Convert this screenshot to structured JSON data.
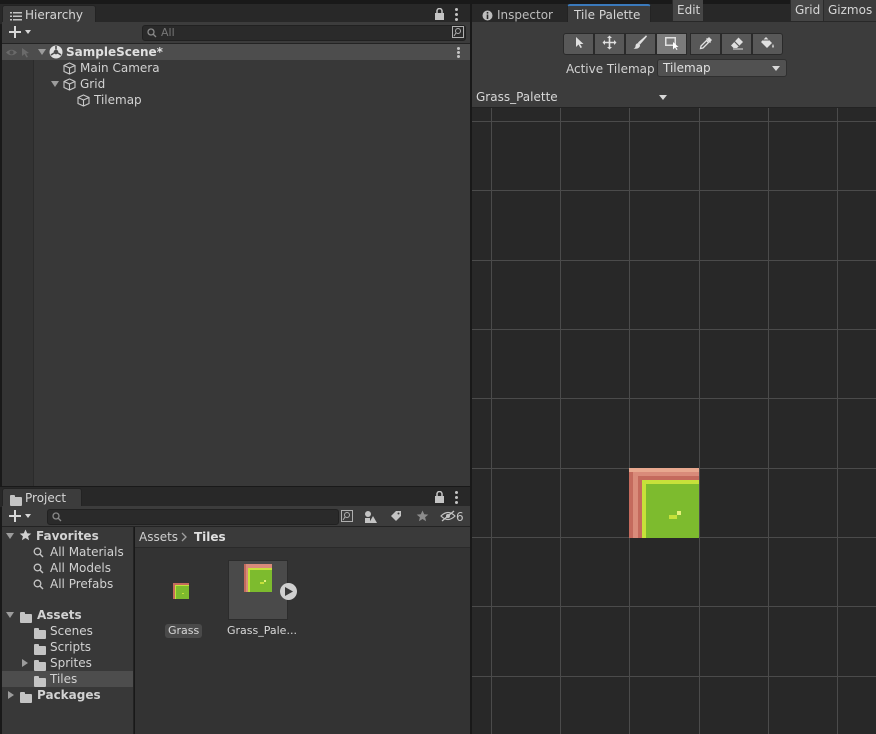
{
  "hierarchy": {
    "tab_label": "Hierarchy",
    "search_placeholder": "All",
    "items": [
      {
        "label": "SampleScene*"
      },
      {
        "label": "Main Camera"
      },
      {
        "label": "Grid"
      },
      {
        "label": "Tilemap"
      }
    ]
  },
  "right_panel": {
    "tabs": [
      {
        "label": "Inspector"
      },
      {
        "label": "Tile Palette"
      }
    ],
    "tools": [
      "select-tool-icon",
      "move-tool-icon",
      "paint-brush-icon",
      "box-fill-icon",
      "picker-icon",
      "eraser-icon",
      "fill-bucket-icon"
    ],
    "active_tilemap_label": "Active Tilemap",
    "active_tilemap_value": "Tilemap",
    "palette_name": "Grass_Palette",
    "edit_label": "Edit",
    "grid_label": "Grid",
    "gizmos_label": "Gizmos"
  },
  "project": {
    "tab_label": "Project",
    "hidden_count": "6",
    "breadcrumb": {
      "root": "Assets",
      "current": "Tiles"
    },
    "tree": {
      "favorites_label": "Favorites",
      "favorites": [
        {
          "label": "All Materials"
        },
        {
          "label": "All Models"
        },
        {
          "label": "All Prefabs"
        }
      ],
      "assets_label": "Assets",
      "assets": [
        {
          "label": "Scenes"
        },
        {
          "label": "Scripts"
        },
        {
          "label": "Sprites"
        },
        {
          "label": "Tiles"
        }
      ],
      "packages_label": "Packages"
    },
    "files": [
      {
        "label": "Grass"
      },
      {
        "label": "Grass_Pale..."
      }
    ]
  },
  "colors": {
    "accent": "#3a79bb",
    "tile_salmon": "#d98b7a",
    "tile_red": "#c46a5d",
    "tile_green": "#7dbb2e",
    "tile_lightgreen": "#c6e13a"
  }
}
